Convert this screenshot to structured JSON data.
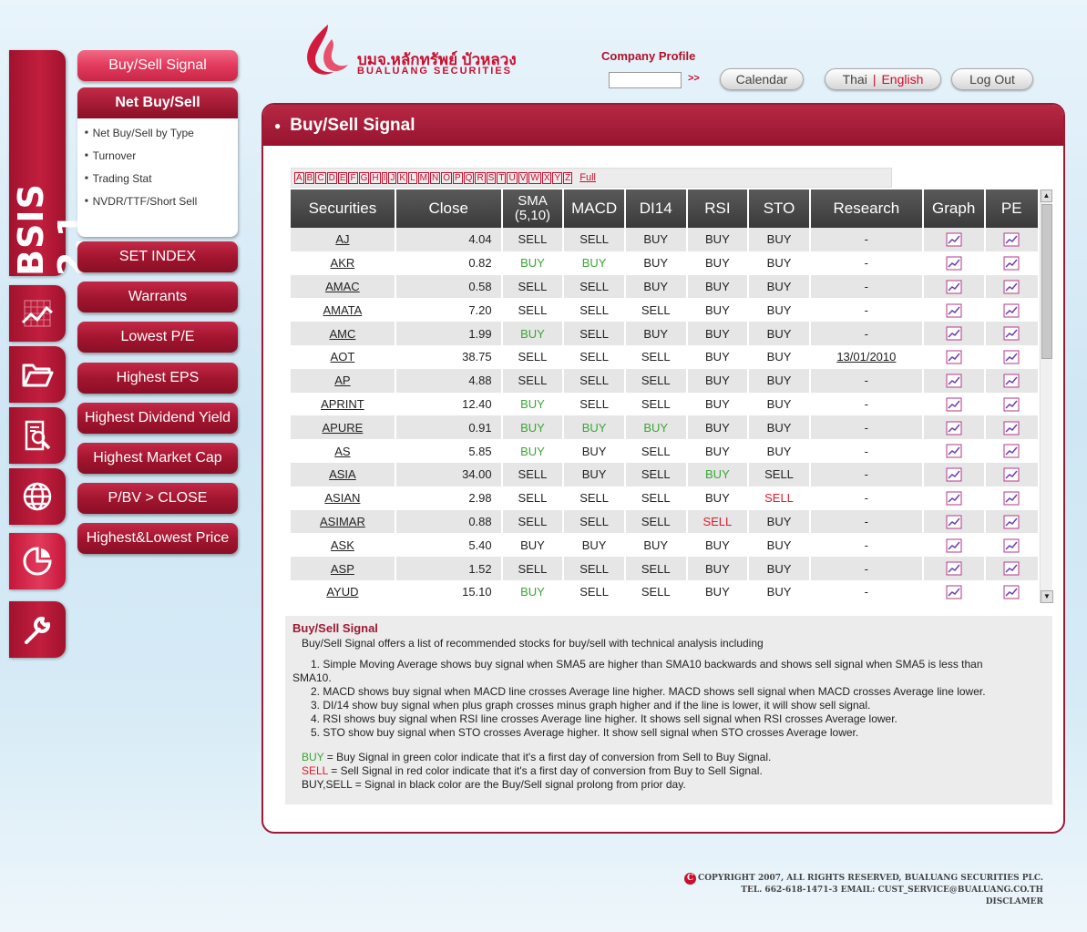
{
  "brand": {
    "vertical_title": "BSIS 2.1"
  },
  "side_icons": [
    "chart-icon",
    "folder-icon",
    "report-search-icon",
    "globe-icon",
    "pie-chart-icon",
    "wrench-icon"
  ],
  "menu": {
    "buy_sell_signal": "Buy/Sell Signal",
    "net_buy_sell": "Net Buy/Sell",
    "sub_items": [
      "Net Buy/Sell by Type",
      "Turnover",
      "Trading Stat",
      "NVDR/TTF/Short Sell"
    ],
    "buttons": [
      "SET INDEX",
      "Warrants",
      "Lowest P/E",
      "Highest EPS",
      "Highest Dividend Yield",
      "Highest Market Cap",
      "P/BV > CLOSE",
      "Highest&Lowest Price"
    ]
  },
  "header": {
    "logo_thai": "บมจ.หลักทรัพย์ บัวหลวง",
    "logo_eng": "BUALUANG SECURITIES",
    "company_profile_label": "Company Profile",
    "company_profile_value": "",
    "go": ">>",
    "calendar": "Calendar",
    "lang_thai": "Thai",
    "lang_sep": "|",
    "lang_english": "English",
    "logout": "Log Out"
  },
  "panel": {
    "title": "Buy/Sell Signal",
    "alphabet": [
      "A",
      "B",
      "C",
      "D",
      "E",
      "F",
      "G",
      "H",
      "I",
      "J",
      "K",
      "L",
      "M",
      "N",
      "O",
      "P",
      "Q",
      "R",
      "S",
      "T",
      "U",
      "V",
      "W",
      "X",
      "Y",
      "Z"
    ],
    "full_label": "Full"
  },
  "table": {
    "headers": {
      "securities": "Securities",
      "close": "Close",
      "sma": "SMA",
      "sma_sub": "(5,10)",
      "macd": "MACD",
      "di14": "DI14",
      "rsi": "RSI",
      "sto": "STO",
      "research": "Research",
      "graph": "Graph",
      "pe": "PE"
    },
    "rows": [
      {
        "sec": "AJ",
        "close": "4.04",
        "sma": "SELL",
        "macd": "SELL",
        "di": "BUY",
        "rsi": "BUY",
        "sto": "BUY",
        "research": "-",
        "c": {}
      },
      {
        "sec": "AKR",
        "close": "0.82",
        "sma": "BUY",
        "macd": "BUY",
        "di": "BUY",
        "rsi": "BUY",
        "sto": "BUY",
        "research": "-",
        "c": {
          "sma": "g",
          "macd": "g"
        }
      },
      {
        "sec": "AMAC",
        "close": "0.58",
        "sma": "SELL",
        "macd": "SELL",
        "di": "BUY",
        "rsi": "BUY",
        "sto": "BUY",
        "research": "-",
        "c": {}
      },
      {
        "sec": "AMATA",
        "close": "7.20",
        "sma": "SELL",
        "macd": "SELL",
        "di": "SELL",
        "rsi": "BUY",
        "sto": "BUY",
        "research": "-",
        "c": {}
      },
      {
        "sec": "AMC",
        "close": "1.99",
        "sma": "BUY",
        "macd": "SELL",
        "di": "BUY",
        "rsi": "BUY",
        "sto": "BUY",
        "research": "-",
        "c": {
          "sma": "g"
        }
      },
      {
        "sec": "AOT",
        "close": "38.75",
        "sma": "SELL",
        "macd": "SELL",
        "di": "SELL",
        "rsi": "BUY",
        "sto": "BUY",
        "research": "13/01/2010",
        "c": {}
      },
      {
        "sec": "AP",
        "close": "4.88",
        "sma": "SELL",
        "macd": "SELL",
        "di": "SELL",
        "rsi": "BUY",
        "sto": "BUY",
        "research": "-",
        "c": {}
      },
      {
        "sec": "APRINT",
        "close": "12.40",
        "sma": "BUY",
        "macd": "SELL",
        "di": "SELL",
        "rsi": "BUY",
        "sto": "BUY",
        "research": "-",
        "c": {
          "sma": "g"
        }
      },
      {
        "sec": "APURE",
        "close": "0.91",
        "sma": "BUY",
        "macd": "BUY",
        "di": "BUY",
        "rsi": "BUY",
        "sto": "BUY",
        "research": "-",
        "c": {
          "sma": "g",
          "macd": "g",
          "di": "g"
        }
      },
      {
        "sec": "AS",
        "close": "5.85",
        "sma": "BUY",
        "macd": "BUY",
        "di": "SELL",
        "rsi": "BUY",
        "sto": "BUY",
        "research": "-",
        "c": {
          "sma": "g"
        }
      },
      {
        "sec": "ASIA",
        "close": "34.00",
        "sma": "SELL",
        "macd": "BUY",
        "di": "SELL",
        "rsi": "BUY",
        "sto": "SELL",
        "research": "-",
        "c": {
          "rsi": "g"
        }
      },
      {
        "sec": "ASIAN",
        "close": "2.98",
        "sma": "SELL",
        "macd": "SELL",
        "di": "SELL",
        "rsi": "BUY",
        "sto": "SELL",
        "research": "-",
        "c": {
          "sto": "r"
        }
      },
      {
        "sec": "ASIMAR",
        "close": "0.88",
        "sma": "SELL",
        "macd": "SELL",
        "di": "SELL",
        "rsi": "SELL",
        "sto": "BUY",
        "research": "-",
        "c": {
          "rsi": "r"
        }
      },
      {
        "sec": "ASK",
        "close": "5.40",
        "sma": "BUY",
        "macd": "BUY",
        "di": "BUY",
        "rsi": "BUY",
        "sto": "BUY",
        "research": "-",
        "c": {}
      },
      {
        "sec": "ASP",
        "close": "1.52",
        "sma": "SELL",
        "macd": "SELL",
        "di": "SELL",
        "rsi": "BUY",
        "sto": "BUY",
        "research": "-",
        "c": {}
      },
      {
        "sec": "AYUD",
        "close": "15.10",
        "sma": "BUY",
        "macd": "SELL",
        "di": "SELL",
        "rsi": "BUY",
        "sto": "BUY",
        "research": "-",
        "c": {
          "sma": "g"
        }
      }
    ]
  },
  "info": {
    "title": "Buy/Sell Signal",
    "intro": "Buy/Sell Signal offers a list of recommended stocks for buy/sell with technical analysis including",
    "item1a": "1. Simple Moving Average shows buy signal when SMA5 are higher than SMA10 backwards and shows sell signal when SMA5 is less than",
    "item1b": "SMA10.",
    "item2": "2. MACD shows buy signal when MACD line crosses Average line higher. MACD shows sell signal when MACD crosses Average line lower.",
    "item3": "3. DI/14 show buy signal when plus graph crosses minus graph higher and if the line is lower, it will show sell signal.",
    "item4": "4. RSI shows buy signal when RSI line crosses Average line higher. It shows sell signal when RSI crosses Average lower.",
    "item5": "5. STO show buy signal when STO crosses Average higher. It show sell signal when STO crosses Average lower.",
    "legend_buy_word": "BUY",
    "legend_buy": " = Buy Signal in green color indicate that it's a first day of conversion from Sell to Buy Signal.",
    "legend_sell_word": "SELL",
    "legend_sell": " = Sell Signal in red color indicate that it's a first day of conversion from Buy to Sell Signal.",
    "legend_black": "BUY,SELL = Signal in black color are the Buy/Sell signal prolong from prior day."
  },
  "footer": {
    "c_mark": "C",
    "copyright": "COPYRIGHT 2007, ALL RIGHTS RESERVED, BUALUANG SECURITIES PLC.",
    "contact": "TEL. 662-618-1471-3 EMAIL: CUST_SERVICE@BUALUANG.CO.TH",
    "disclaimer": "DISCLAMER"
  },
  "colors": {
    "brand": "#a1122d",
    "buy_green": "#3aa635",
    "sell_red": "#e01a2a",
    "header_dark": "#3a3a3a"
  }
}
